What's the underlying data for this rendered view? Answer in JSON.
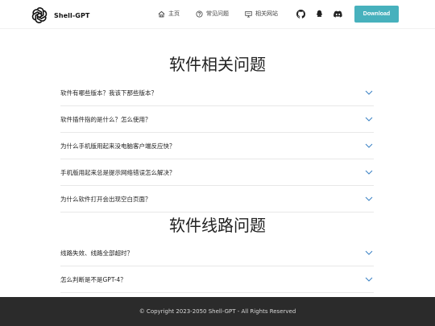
{
  "header": {
    "brand_name": "Shell-GPT",
    "nav": [
      {
        "label": "主页",
        "icon": "home-icon"
      },
      {
        "label": "常见问题",
        "icon": "help-icon"
      },
      {
        "label": "相关网站",
        "icon": "monitor-icon"
      }
    ],
    "socials": [
      "github-icon",
      "qq-icon",
      "discord-icon"
    ],
    "download_label": "Download"
  },
  "sections": [
    {
      "title": "软件相关问题",
      "items": [
        "软件有哪些版本？我该下那些版本？",
        "软件插件指的是什么？怎么使用？",
        "为什么手机版用起来没电脑客户端反应快？",
        "手机版用起来总是提示网络错误怎么解决？",
        "为什么软件打开会出现空白页面？"
      ]
    },
    {
      "title": "软件线路问题",
      "items": [
        "线路失效、线路全部超时？",
        "怎么判断是不是GPT-4？"
      ]
    }
  ],
  "footer": {
    "copyright": "© Copyright 2023-2050 Shell-GPT - All Rights Reserved"
  },
  "colors": {
    "accent": "#47b1bd",
    "chevron": "#3b82c4",
    "footer_bg": "#2b2b2b"
  }
}
